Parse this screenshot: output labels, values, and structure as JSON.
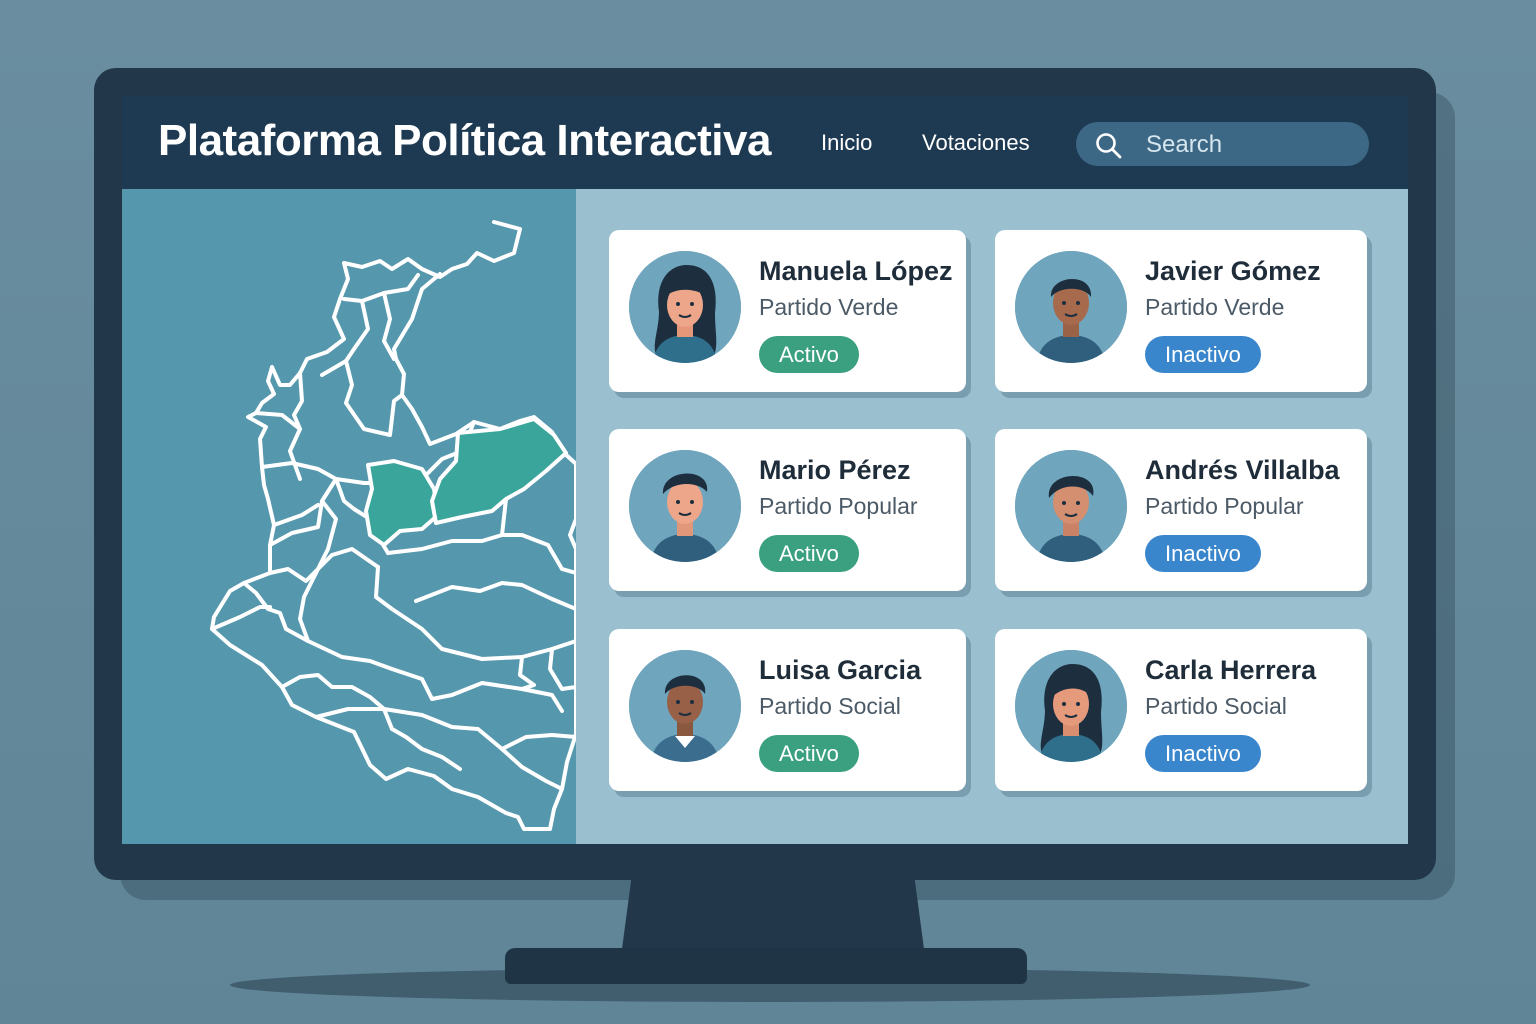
{
  "app": {
    "title": "Plataforma Política Interactiva"
  },
  "nav": {
    "items": [
      "Inicio",
      "Votaciones"
    ]
  },
  "search": {
    "placeholder": "Search",
    "icon": "search-icon"
  },
  "map": {
    "region": "Colombia departments",
    "highlight_color": "#3aa59a"
  },
  "colors": {
    "header": "#1e3a52",
    "active_badge": "#3aa07f",
    "inactive_badge": "#3a86cc"
  },
  "candidates": [
    {
      "name": "Manuela López",
      "party": "Partido Verde",
      "status": "Activo"
    },
    {
      "name": "Javier Gómez",
      "party": "Partido Verde",
      "status": "Inactivo"
    },
    {
      "name": "Mario Pérez",
      "party": "Partido Popular",
      "status": "Activo"
    },
    {
      "name": "Andrés Villalba",
      "party": "Partido Popular",
      "status": "Inactivo"
    },
    {
      "name": "Luisa Garcia",
      "party": "Partido Social",
      "status": "Activo"
    },
    {
      "name": "Carla Herrera",
      "party": "Partido Social",
      "status": "Inactivo"
    }
  ]
}
